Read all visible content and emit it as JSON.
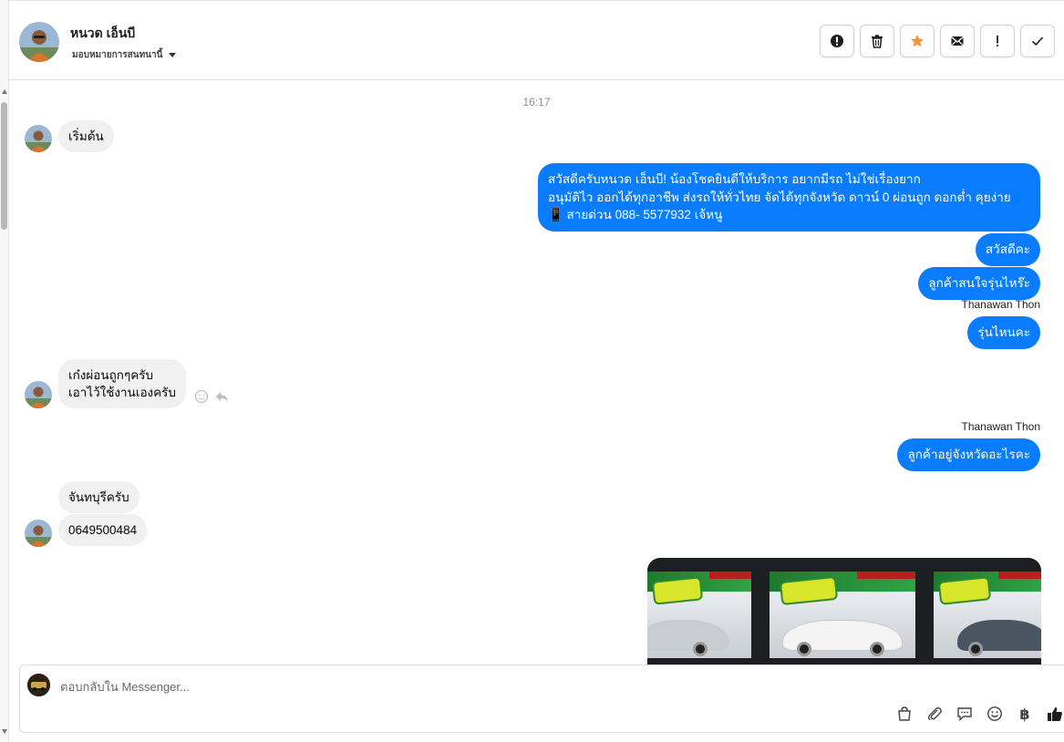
{
  "header": {
    "contact_name": "หนวด เอ็นบี",
    "assign_label": "มอบหมายการสนทนานี้",
    "actions": [
      "spam-report",
      "delete",
      "star",
      "mark-unread",
      "important",
      "done"
    ]
  },
  "chat": {
    "timestamp": "16:17",
    "messages": [
      {
        "from": "customer",
        "text": "เริ่มต้น"
      },
      {
        "from": "page",
        "text": "สวัสดีครับหนวด เอ็นบี! น้องโชคยินดีให้บริการ อยากมีรถ ไม่ใช่เรื่องยาก\nอนุมัติไว ออกได้ทุกอาชีพ ส่งรถให้ทั่วไทย จัดได้ทุกจังหวัด ดาวน์ 0  ผ่อนถูก ดอกต่ำ คุยง่าย\n📱 สายด่วน 088- 5577932 เจ้หนู"
      },
      {
        "from": "page",
        "text": "สวัสดีคะ"
      },
      {
        "from": "page",
        "text": "ลูกค้าสนใจรุ่นไหร๊ะ"
      },
      {
        "from": "page",
        "sender": "Thanawan Thon",
        "text": "รุ่นไหนคะ"
      },
      {
        "from": "customer",
        "text": "เก๋งผ่อนถูกๆครับ\nเอาไว้ใช้งานเองครับ"
      },
      {
        "from": "page",
        "sender": "Thanawan Thon",
        "text": "ลูกค้าอยู่จังหวัดอะไรคะ"
      },
      {
        "from": "customer",
        "text": "จันทบุรีครับ"
      },
      {
        "from": "customer",
        "text": "0649500484"
      }
    ]
  },
  "composer": {
    "placeholder": "ตอบกลับใน Messenger...",
    "tools": [
      "bag-icon",
      "paperclip-icon",
      "saved-reply-icon",
      "emoji-icon",
      "baht-icon",
      "like-icon"
    ],
    "baht_symbol": "฿"
  },
  "colors": {
    "outgoing_bubble": "#0a7cff",
    "incoming_bubble": "#f0f0f0",
    "star": "#f7923a"
  }
}
